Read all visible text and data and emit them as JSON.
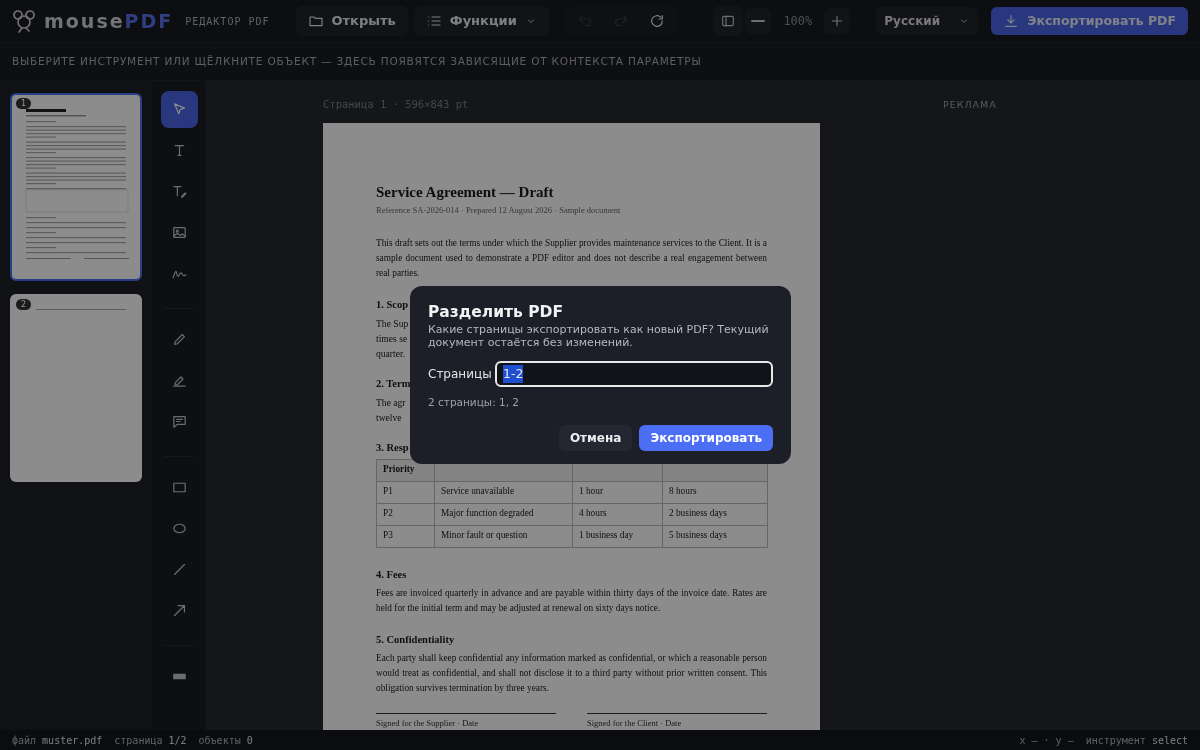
{
  "header": {
    "logo": {
      "name": "mouse",
      "accent": "PDF"
    },
    "subtitle": "РЕДАКТОР PDF",
    "open_button": "Открыть",
    "functions_button": "Функции",
    "history": [
      {
        "kind": "undo",
        "disabled": true
      },
      {
        "kind": "redo",
        "disabled": true
      },
      {
        "kind": "reload",
        "disabled": false
      }
    ],
    "zoom": "100%",
    "language": "Русский",
    "export_button": "Экспортировать PDF"
  },
  "hint": "ВЫБЕРИТЕ ИНСТРУМЕНТ ИЛИ ЩЁЛКНИТЕ ОБЪЕКТ — ЗДЕСЬ ПОЯВЯТСЯ ЗАВИСЯЩИЕ ОТ КОНТЕКСТА ПАРАМЕТРЫ",
  "thumbnails": [
    {
      "label": "1",
      "selected": true
    },
    {
      "label": "2",
      "selected": false
    }
  ],
  "tool_groups": [
    [
      {
        "selected": true
      },
      {
        "selected": false
      },
      {
        "selected": false
      },
      {
        "selected": false
      },
      {
        "selected": false
      }
    ],
    [
      {
        "selected": false
      },
      {
        "selected": false
      },
      {
        "selected": false
      }
    ],
    [
      {
        "selected": false
      },
      {
        "selected": false
      },
      {
        "selected": false
      },
      {
        "selected": false
      }
    ],
    [
      {
        "selected": false
      }
    ]
  ],
  "page_label": "Страница 1 · 596×843 pt",
  "ad_label": "РЕКЛАМА",
  "document": {
    "title": "Service Agreement — Draft",
    "meta": "Reference SA-2026-014 · Prepared 12 August 2026 · Sample document",
    "blocks": [
      {
        "kind": "paragraph",
        "text": "This draft sets out the terms under which the Supplier provides maintenance services to the Client. It is a sample document used to demonstrate a PDF editor and does not describe a real engagement between real parties."
      },
      {
        "kind": "heading",
        "text": "1. Scop"
      },
      {
        "kind": "lines",
        "lines": [
          "The Sup",
          "times se",
          "quarter."
        ]
      },
      {
        "kind": "heading",
        "text": "2. Term"
      },
      {
        "kind": "lines",
        "lines": [
          "The agr",
          "twelve"
        ]
      },
      {
        "kind": "heading",
        "text": "3. Resp"
      },
      {
        "kind": "table",
        "header": [
          "Priority"
        ],
        "rows": [
          [
            "P1",
            "Service unavailable",
            "1 hour",
            "8 hours"
          ],
          [
            "P2",
            "Major function degraded",
            "4 hours",
            "2 business days"
          ],
          [
            "P3",
            "Minor fault or question",
            "1 business day",
            "5 business days"
          ]
        ]
      },
      {
        "kind": "heading",
        "text": "4. Fees"
      },
      {
        "kind": "paragraph",
        "text": "Fees are invoiced quarterly in advance and are payable within thirty days of the invoice date. Rates are held for the initial term and may be adjusted at renewal on sixty days notice."
      },
      {
        "kind": "heading",
        "text": "5. Confidentiality"
      },
      {
        "kind": "paragraph",
        "text": "Each party shall keep confidential any information marked as confidential, or which a reasonable person would treat as confidential, and shall not disclose it to a third party without prior written consent. This obligation survives termination by three years."
      },
      {
        "kind": "signatures",
        "labels": [
          "Signed for the Supplier · Date",
          "Signed for the Client · Date"
        ]
      }
    ]
  },
  "dialog": {
    "title": "Разделить PDF",
    "description": "Какие страницы экспортировать как новый PDF? Текущий документ остаётся без изменений.",
    "field_label": "Страницы",
    "value": "1-2",
    "value_selected": true,
    "summary": "2 страницы: 1, 2",
    "cancel": "Отмена",
    "confirm": "Экспортировать"
  },
  "status_bar": {
    "left": [
      {
        "label": "файл",
        "value": "muster.pdf"
      },
      {
        "label": "страница",
        "value": "1/2"
      },
      {
        "label": "объекты",
        "value": "0"
      }
    ],
    "coords": "x – · y –",
    "tool_label": "инструмент",
    "tool_value": "select"
  }
}
